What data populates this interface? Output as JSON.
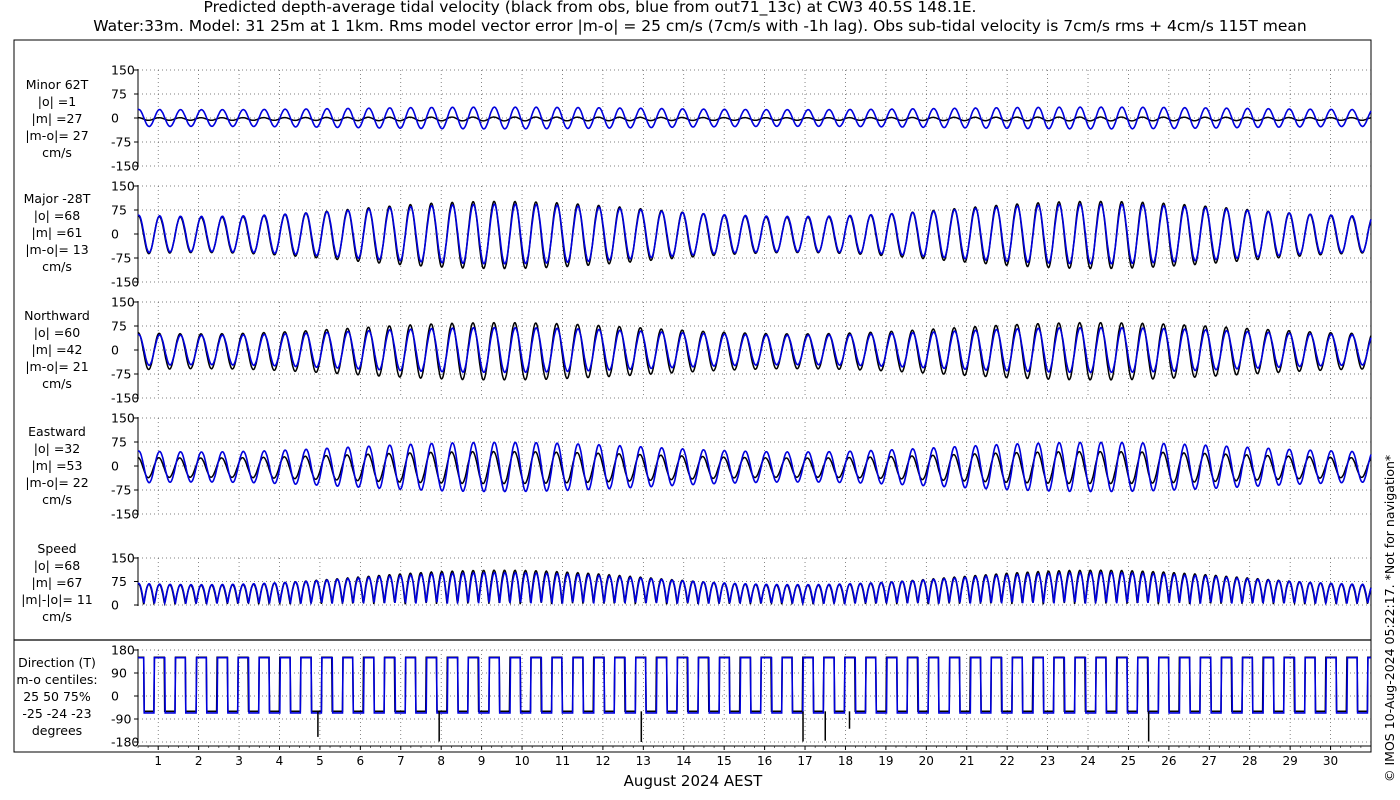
{
  "title": {
    "line1": "Predicted depth-average tidal velocity (black from obs, blue from out71_13c) at CW3 40.5S 148.1E.",
    "line2": "Water:33m. Model: 31 25m at 1 1km. Rms model vector error |m-o| = 25 cm/s (7cm/s with -1h lag). Obs sub-tidal velocity is 7cm/s rms + 4cm/s 115T mean"
  },
  "side_note": "© IMOS 10-Aug-2024 05:22:17. *Not for navigation*",
  "xlabel": "August 2024 AEST",
  "colors": {
    "obs": "#000000",
    "model": "#0000dd",
    "grid": "#555555"
  },
  "chart_data": [
    {
      "id": "minor",
      "type": "line",
      "label_lines": [
        "Minor 62T",
        "|o| =1",
        "|m| =27",
        "|m-o|= 27",
        "cm/s"
      ],
      "ylim": [
        -150,
        150
      ],
      "yticks": [
        -150,
        -75,
        0,
        75,
        150
      ],
      "x_unit": "day of August 2024",
      "x_range": [
        0.5,
        31
      ],
      "series": [
        {
          "role": "obs",
          "signal": "M2 tidal",
          "amplitude": 5,
          "spring_extra": 2,
          "phase_deg": 10,
          "offset": -3
        },
        {
          "role": "model",
          "signal": "M2 tidal",
          "amplitude": 30,
          "spring_extra": 8,
          "phase_deg": 0,
          "offset": 0
        }
      ]
    },
    {
      "id": "major",
      "type": "line",
      "label_lines": [
        "Major -28T",
        "|o| =68",
        "|m| =61",
        "|m-o|= 13",
        "cm/s"
      ],
      "ylim": [
        -150,
        150
      ],
      "yticks": [
        -150,
        -75,
        0,
        75,
        150
      ],
      "x_unit": "day of August 2024",
      "x_range": [
        0.5,
        31
      ],
      "series": [
        {
          "role": "obs",
          "signal": "M2 tidal",
          "amplitude": 80,
          "spring_extra": 50,
          "phase_deg": 5,
          "offset": -3
        },
        {
          "role": "model",
          "signal": "M2 tidal",
          "amplitude": 74,
          "spring_extra": 38,
          "phase_deg": 0,
          "offset": 0
        }
      ]
    },
    {
      "id": "north",
      "type": "line",
      "label_lines": [
        "Northward",
        "|o| =60",
        "|m| =42",
        "|m-o|= 21",
        "cm/s"
      ],
      "ylim": [
        -150,
        150
      ],
      "yticks": [
        -150,
        -75,
        0,
        75,
        150
      ],
      "x_unit": "day of August 2024",
      "x_range": [
        0.5,
        31
      ],
      "series": [
        {
          "role": "obs",
          "signal": "M2 tidal",
          "amplitude": 72,
          "spring_extra": 35,
          "phase_deg": 8,
          "offset": -4
        },
        {
          "role": "model",
          "signal": "M2 tidal",
          "amplitude": 58,
          "spring_extra": 24,
          "phase_deg": 0,
          "offset": 0
        }
      ]
    },
    {
      "id": "east",
      "type": "line",
      "label_lines": [
        "Eastward",
        "|o| =32",
        "|m| =53",
        "|m-o|= 22",
        "cm/s"
      ],
      "ylim": [
        -150,
        150
      ],
      "yticks": [
        -150,
        -75,
        0,
        75,
        150
      ],
      "x_unit": "day of August 2024",
      "x_range": [
        0.5,
        31
      ],
      "series": [
        {
          "role": "obs",
          "signal": "M2 tidal",
          "amplitude": 40,
          "spring_extra": 20,
          "phase_deg": 15,
          "offset": -5
        },
        {
          "role": "model",
          "signal": "M2 tidal",
          "amplitude": 62,
          "spring_extra": 30,
          "phase_deg": 0,
          "offset": -3
        }
      ]
    },
    {
      "id": "speed",
      "type": "line",
      "label_lines": [
        "Speed",
        "|o| =68",
        "|m| =67",
        "|m|-|o|= 11",
        "cm/s"
      ],
      "ylim": [
        0,
        150
      ],
      "yticks": [
        0,
        75,
        150
      ],
      "x_unit": "day of August 2024",
      "x_range": [
        0.5,
        31
      ],
      "series": [
        {
          "role": "obs",
          "signal": "rectified M2 speed",
          "amplitude": 85,
          "spring_extra": 48,
          "phase_deg": 5,
          "offset": 2
        },
        {
          "role": "model",
          "signal": "rectified M2 speed",
          "amplitude": 80,
          "spring_extra": 38,
          "phase_deg": 0,
          "offset": 4
        }
      ]
    },
    {
      "id": "direction",
      "type": "line",
      "label_lines": [
        "Direction (T)",
        "m-o centiles:",
        "25  50  75%",
        "-25 -24 -23",
        "degrees"
      ],
      "ylim": [
        -180,
        180
      ],
      "yticks": [
        -180,
        -90,
        0,
        90,
        180
      ],
      "x_unit": "day of August 2024",
      "x_range": [
        0.5,
        31
      ],
      "x_ticks": [
        1,
        2,
        3,
        4,
        5,
        6,
        7,
        8,
        9,
        10,
        11,
        12,
        13,
        14,
        15,
        16,
        17,
        18,
        19,
        20,
        21,
        22,
        23,
        24,
        25,
        26,
        27,
        28,
        29,
        30
      ],
      "series": [
        {
          "role": "obs",
          "signal": "square-wave direction",
          "high_deg": 152,
          "low_deg": -60
        },
        {
          "role": "model",
          "signal": "square-wave direction",
          "high_deg": 150,
          "low_deg": -66
        }
      ],
      "obs_spikes_deg": [
        {
          "day": 4.95,
          "value": -160
        },
        {
          "day": 7.95,
          "value": -178
        },
        {
          "day": 12.95,
          "value": -180
        },
        {
          "day": 16.95,
          "value": -178
        },
        {
          "day": 17.5,
          "value": -175
        },
        {
          "day": 18.1,
          "value": -128
        },
        {
          "day": 25.5,
          "value": -178
        }
      ]
    }
  ]
}
